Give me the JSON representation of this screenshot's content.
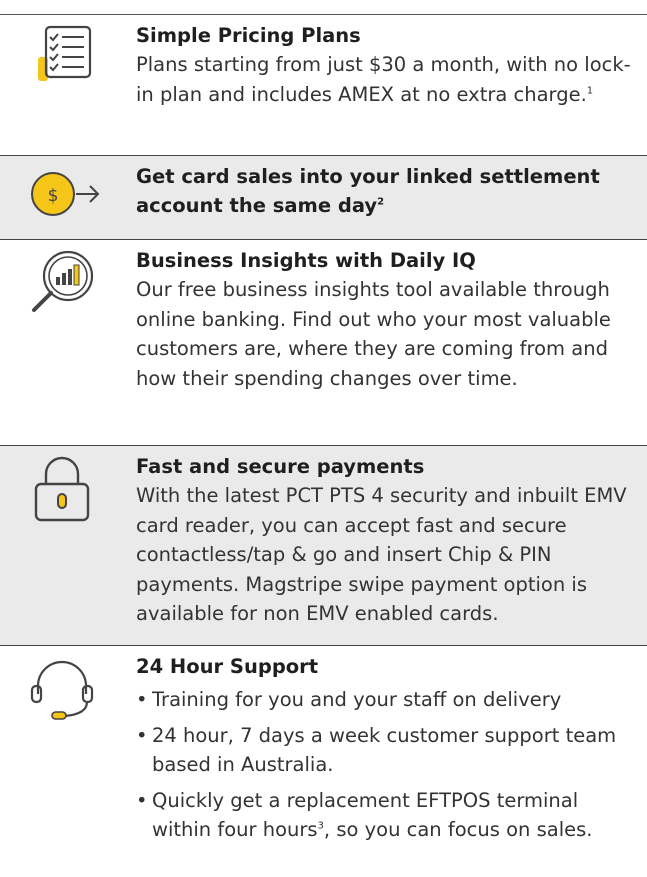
{
  "colors": {
    "accent": "#f5c518",
    "border": "#444444",
    "shade": "#eaeaea"
  },
  "features": [
    {
      "icon": "checklist-icon",
      "title": "Simple Pricing Plans",
      "text": "Plans starting from just $30 a month, with no lock-in plan and includes AMEX at no extra charge.",
      "sup": "1"
    },
    {
      "icon": "coin-arrow-icon",
      "title": "Get card sales into your linked settlement account the same day",
      "title_sup": "2",
      "coin_symbol": "$"
    },
    {
      "icon": "magnifier-chart-icon",
      "title": "Business Insights with Daily IQ",
      "text": "Our free business insights tool available through online banking. Find out who your most valuable customers are, where they are coming from and how their spending changes over time."
    },
    {
      "icon": "padlock-icon",
      "title": "Fast and secure payments",
      "text": "With the latest PCT PTS 4 security and inbuilt EMV card reader, you can accept fast and secure contactless/tap & go and insert Chip & PIN payments. Magstripe swipe payment option is available for non EMV enabled cards."
    },
    {
      "icon": "headset-icon",
      "title": "24 Hour Support",
      "bullets": [
        "Training for you and your staff on delivery",
        "24 hour, 7 days a week customer support team based in Australia.",
        "Quickly get a replacement EFTPOS terminal within four hours"
      ],
      "bullet3_sup": "3",
      "bullet3_tail": ", so you can focus on sales."
    }
  ]
}
